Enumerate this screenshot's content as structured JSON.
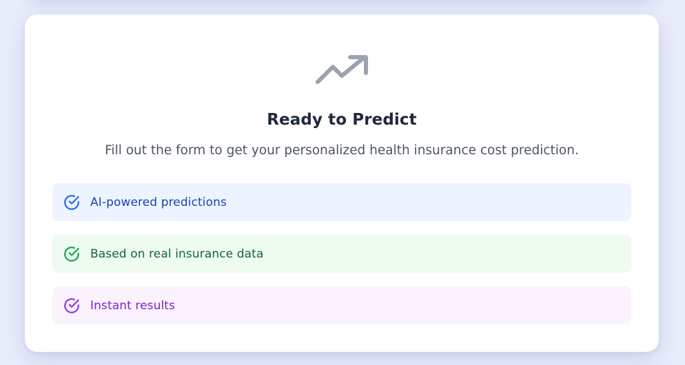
{
  "card": {
    "title": "Ready to Predict",
    "subtitle": "Fill out the form to get your personalized health insurance cost prediction.",
    "hero_icon": "trending-up-icon"
  },
  "features": [
    {
      "label": "AI-powered predictions",
      "icon": "check-circle-icon",
      "accent": "#2563eb",
      "background": "#eef4ff"
    },
    {
      "label": "Based on real insurance data",
      "icon": "check-circle-icon",
      "accent": "#16a34a",
      "background": "#edfbf1"
    },
    {
      "label": "Instant results",
      "icon": "check-circle-icon",
      "accent": "#9333ea",
      "background": "#faf3fe"
    }
  ],
  "colors": {
    "page_background": "#e8ecfb",
    "icon_gray": "#9ca3af",
    "title": "#1f2937",
    "subtitle": "#4b5563"
  }
}
